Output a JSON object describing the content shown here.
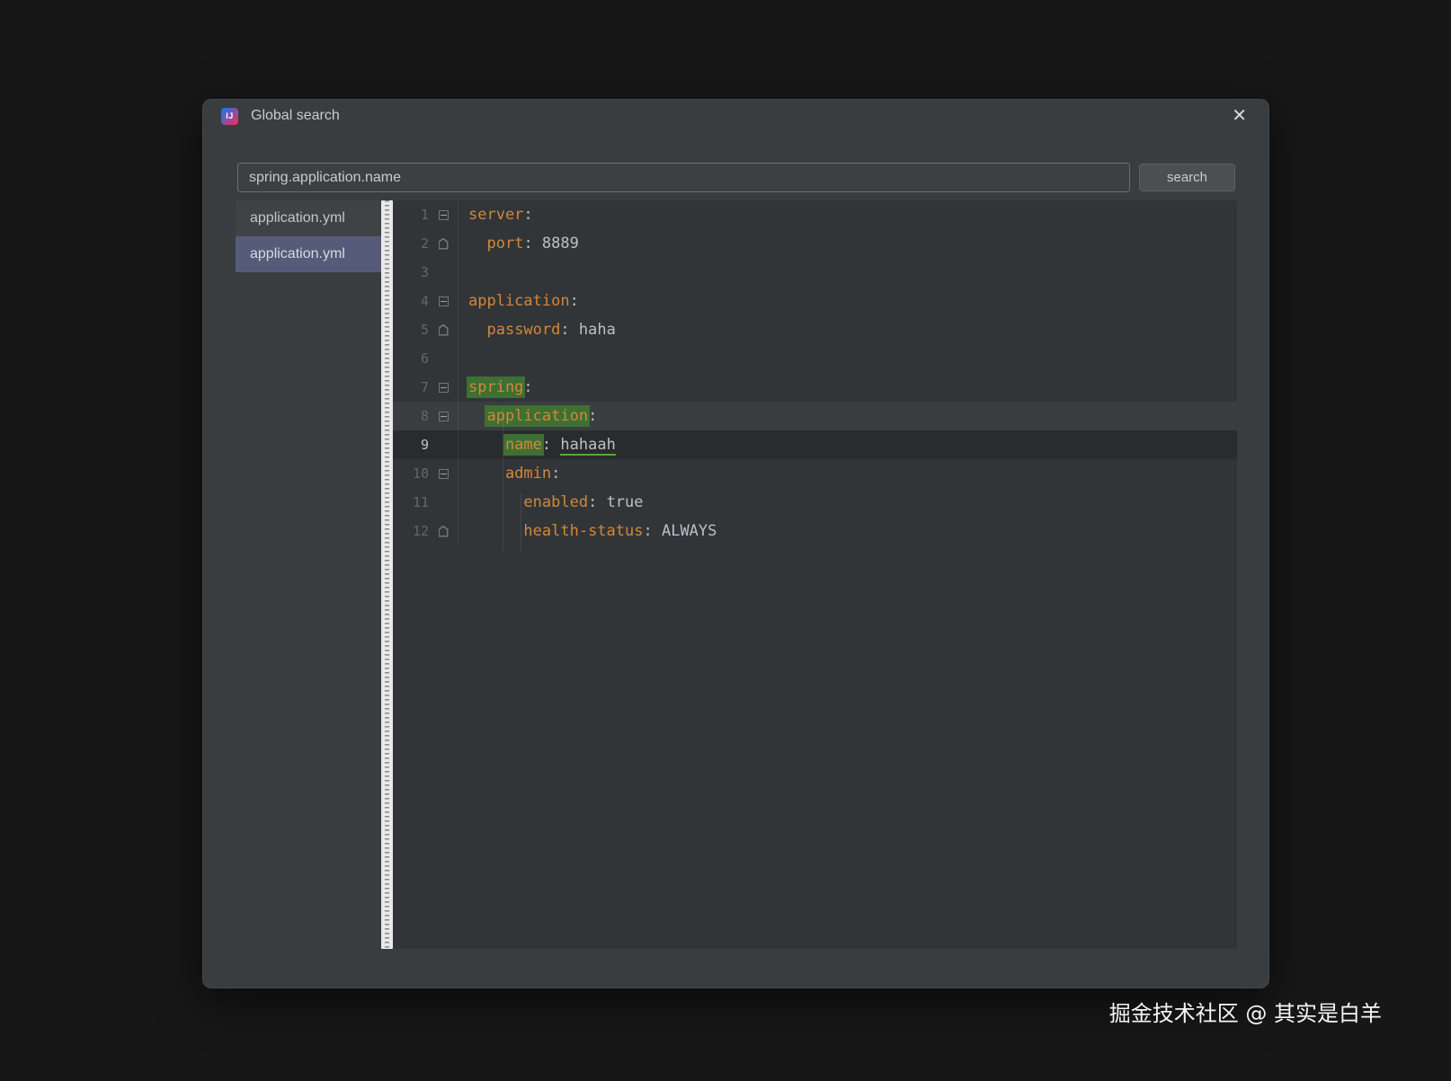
{
  "window": {
    "title": "Global search",
    "app_icon": "IJ",
    "close_glyph": "✕"
  },
  "search": {
    "value": "spring.application.name",
    "button": "search"
  },
  "files": [
    {
      "name": "application.yml",
      "selected": false
    },
    {
      "name": "application.yml",
      "selected": true
    }
  ],
  "editor": {
    "current_line": 9,
    "match_line": 8,
    "lines": [
      {
        "n": 1,
        "fold": "start",
        "code": [
          {
            "t": "server",
            "k": "key"
          },
          {
            "t": ":",
            "k": "p"
          }
        ]
      },
      {
        "n": 2,
        "fold": "end",
        "code": [
          {
            "t": "  "
          },
          {
            "t": "port",
            "k": "key"
          },
          {
            "t": ": ",
            "k": "p"
          },
          {
            "t": "8889",
            "k": "val"
          }
        ]
      },
      {
        "n": 3,
        "code": []
      },
      {
        "n": 4,
        "fold": "start",
        "code": [
          {
            "t": "application",
            "k": "key"
          },
          {
            "t": ":",
            "k": "p"
          }
        ]
      },
      {
        "n": 5,
        "fold": "end",
        "code": [
          {
            "t": "  "
          },
          {
            "t": "password",
            "k": "key"
          },
          {
            "t": ": ",
            "k": "p"
          },
          {
            "t": "haha",
            "k": "val"
          }
        ]
      },
      {
        "n": 6,
        "code": []
      },
      {
        "n": 7,
        "fold": "start",
        "code": [
          {
            "t": "spring",
            "k": "key",
            "hl": true
          },
          {
            "t": ":",
            "k": "p"
          }
        ]
      },
      {
        "n": 8,
        "fold": "start",
        "code": [
          {
            "t": "  "
          },
          {
            "t": "application",
            "k": "key",
            "hl": true
          },
          {
            "t": ":",
            "k": "p"
          }
        ]
      },
      {
        "n": 9,
        "code": [
          {
            "t": "    "
          },
          {
            "t": "name",
            "k": "key",
            "hl": true
          },
          {
            "t": ": ",
            "k": "p"
          },
          {
            "t": "hahaah",
            "k": "val",
            "u": true
          }
        ]
      },
      {
        "n": 10,
        "fold": "start",
        "code": [
          {
            "t": "    "
          },
          {
            "t": "admin",
            "k": "key"
          },
          {
            "t": ":",
            "k": "p"
          }
        ]
      },
      {
        "n": 11,
        "code": [
          {
            "t": "      "
          },
          {
            "t": "enabled",
            "k": "key"
          },
          {
            "t": ": ",
            "k": "p"
          },
          {
            "t": "true",
            "k": "val"
          }
        ]
      },
      {
        "n": 12,
        "fold": "end",
        "code": [
          {
            "t": "      "
          },
          {
            "t": "health-status",
            "k": "key"
          },
          {
            "t": ": ",
            "k": "p"
          },
          {
            "t": "ALWAYS",
            "k": "val"
          }
        ]
      }
    ]
  },
  "watermark": "掘金技术社区 @ 其实是白羊",
  "colors": {
    "key": "#d2873a",
    "value": "#b9c0c7",
    "punct": "#b9c0c7",
    "match_bg": "#3d7032",
    "selection_bg": "#565b79",
    "underline": "#5aa53c",
    "accent_title_icon_a": "#087cfa",
    "accent_title_icon_b": "#fe2857"
  }
}
